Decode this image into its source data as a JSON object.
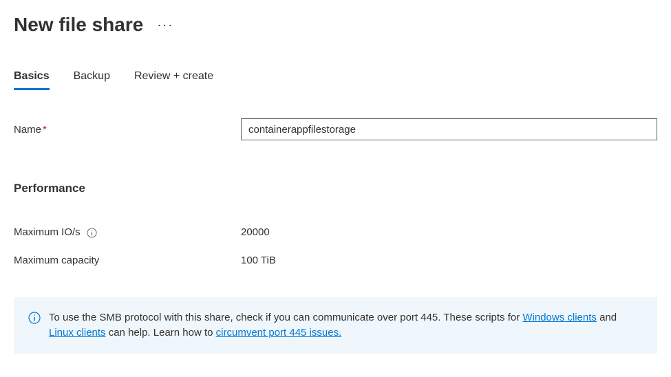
{
  "header": {
    "title": "New file share"
  },
  "tabs": [
    {
      "label": "Basics",
      "active": true
    },
    {
      "label": "Backup",
      "active": false
    },
    {
      "label": "Review + create",
      "active": false
    }
  ],
  "form": {
    "name_label": "Name",
    "name_value": "containerappfilestorage"
  },
  "performance": {
    "heading": "Performance",
    "max_io_label": "Maximum IO/s",
    "max_io_value": "20000",
    "max_capacity_label": "Maximum capacity",
    "max_capacity_value": "100 TiB"
  },
  "info_banner": {
    "text_1": "To use the SMB protocol with this share, check if you can communicate over port 445. These scripts for ",
    "link_1": "Windows clients",
    "text_2": " and ",
    "link_2": "Linux clients",
    "text_3": " can help. Learn how to ",
    "link_3": "circumvent port 445 issues."
  }
}
